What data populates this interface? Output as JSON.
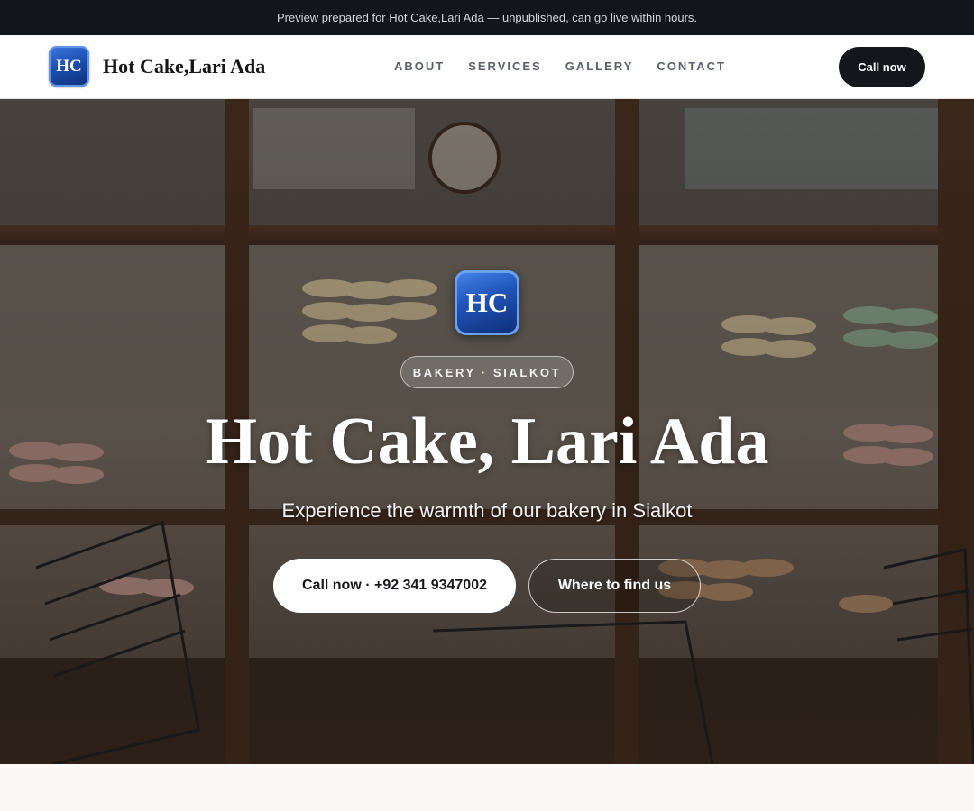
{
  "banner": {
    "text": "Preview prepared for Hot Cake,Lari Ada — unpublished, can go live within hours."
  },
  "header": {
    "logo_initials": "HC",
    "brand_name": "Hot Cake,Lari Ada",
    "nav": [
      {
        "label": "ABOUT"
      },
      {
        "label": "SERVICES"
      },
      {
        "label": "GALLERY"
      },
      {
        "label": "CONTACT"
      }
    ],
    "call_label": "Call now"
  },
  "hero": {
    "logo_initials": "HC",
    "tag": "BAKERY · SIALKOT",
    "title": "Hot Cake, Lari Ada",
    "subtitle": "Experience the warmth of our bakery in Sialkot",
    "primary_button": "Call now · +92 341 9347002",
    "secondary_button": "Where to find us"
  },
  "colors": {
    "banner_bg": "#12151b",
    "dark_button": "#14161c",
    "logo_blue": "#1d4fb0",
    "page_bg": "#faf9f6"
  }
}
